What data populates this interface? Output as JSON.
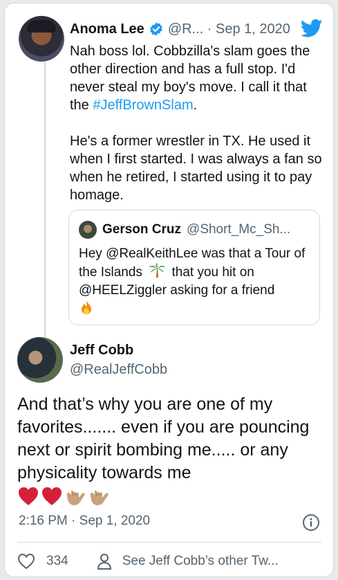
{
  "colors": {
    "link": "#1d9bf0",
    "secondary_text": "#536471",
    "border": "#cfd9de",
    "heart": "#d3213a"
  },
  "reply_tweet": {
    "name": "Anoma Lee",
    "handle_date": "@R... · Sep 1, 2020",
    "para1_pre": "Nah boss lol. Cobbzilla's slam goes the other direction and has a full stop. I'd never steal my boy's move. I call it that the ",
    "hashtag": "#JeffBrownSlam",
    "para1_post": ".",
    "para2": "He's a former wrestler in TX. He used it when I first started.  I was always a fan so when he retired, I started using it to pay homage."
  },
  "quote_tweet": {
    "name": "Gerson Cruz",
    "handle": "@Short_Mc_Sh...",
    "text_pre": "Hey @RealKeithLee was that a Tour of the Islands",
    "text_post": " that you hit on @HEELZiggler asking for a friend"
  },
  "main_tweet": {
    "name": "Jeff Cobb",
    "handle": "@RealJeffCobb",
    "text": "And that’s why you are one of my favorites....... even if you are pouncing next or spirit bombing me..... or any physicality towards me",
    "emojis": [
      "red-heart",
      "red-heart",
      "call-me-hand",
      "call-me-hand"
    ],
    "timestamp": "2:16 PM · Sep 1, 2020",
    "likes": "334",
    "see_more": "See Jeff Cobb’s other Tw..."
  }
}
